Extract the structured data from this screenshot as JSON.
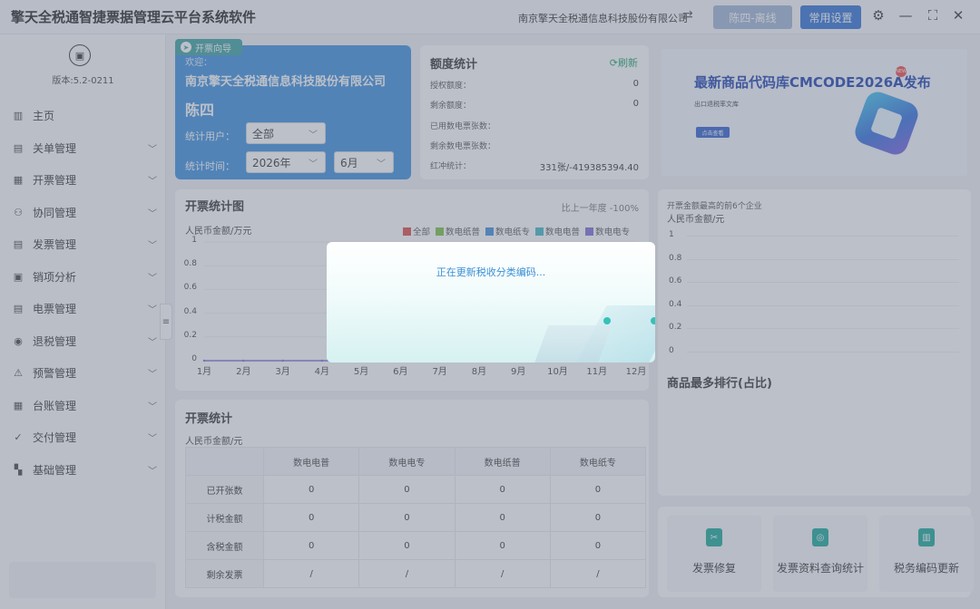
{
  "titlebar": {
    "title": "擎天全税通智捷票据管理云平台系统软件",
    "company": "南京擎天全税通信息科技股份有限公司",
    "user_button": "陈四-离线",
    "settings_button": "常用设置"
  },
  "sidebar": {
    "version": "版本:5.2-0211",
    "items": [
      {
        "label": "主页",
        "icon": "home-icon"
      },
      {
        "label": "关单管理",
        "icon": "document-icon"
      },
      {
        "label": "开票管理",
        "icon": "invoice-icon"
      },
      {
        "label": "协同管理",
        "icon": "team-icon"
      },
      {
        "label": "发票管理",
        "icon": "receipt-icon"
      },
      {
        "label": "销项分析",
        "icon": "analysis-icon"
      },
      {
        "label": "电票管理",
        "icon": "e-invoice-icon"
      },
      {
        "label": "退税管理",
        "icon": "refund-icon"
      },
      {
        "label": "预警管理",
        "icon": "warning-icon"
      },
      {
        "label": "台账管理",
        "icon": "ledger-icon"
      },
      {
        "label": "交付管理",
        "icon": "delivery-icon"
      },
      {
        "label": "基础管理",
        "icon": "grid-icon"
      }
    ]
  },
  "guide": {
    "tag": "开票向导",
    "label": "欢迎：",
    "company": "南京擎天全税通信息科技股份有限公司",
    "user": "陈四",
    "stat_user_label": "统计用户：",
    "stat_user_value": "全部",
    "stat_time_label": "统计时间：",
    "year": "2026年",
    "month": "6月"
  },
  "quota": {
    "title": "额度统计",
    "refresh": "刷新",
    "rows": [
      {
        "label": "授权额度：",
        "value": "0"
      },
      {
        "label": "剩余额度：",
        "value": "0"
      },
      {
        "label": "已用数电票张数：",
        "value": ""
      },
      {
        "label": "剩余数电票张数：",
        "value": ""
      },
      {
        "label": "红冲统计：",
        "value": "331张/-419385394.40"
      }
    ]
  },
  "banner": {
    "title": "最新商品代码库CMCODE2026A发布",
    "hot": "NEW",
    "subtitle": "出口退税率文库",
    "button": "点击查看"
  },
  "invoice_chart": {
    "title": "开票统计图",
    "compare": "比上一年度 -100%",
    "unit": "人民币金额/万元",
    "legend": [
      {
        "name": "全部",
        "color": "#e04b4b"
      },
      {
        "name": "数电纸普",
        "color": "#7cc144"
      },
      {
        "name": "数电纸专",
        "color": "#3d8ee0"
      },
      {
        "name": "数电电普",
        "color": "#3fb8c8"
      },
      {
        "name": "数电电专",
        "color": "#7b6fd8"
      }
    ],
    "y_ticks": [
      "1",
      "0.8",
      "0.6",
      "0.4",
      "0.2",
      "0"
    ],
    "x_ticks": [
      "1月",
      "2月",
      "3月",
      "4月",
      "5月",
      "6月",
      "7月",
      "8月",
      "9月",
      "10月",
      "11月",
      "12月"
    ]
  },
  "chart_data": {
    "type": "line",
    "title": "开票统计图",
    "ylabel": "人民币金额/万元",
    "xlabel": "",
    "ylim": [
      0,
      1
    ],
    "categories": [
      "1月",
      "2月",
      "3月",
      "4月",
      "5月",
      "6月",
      "7月",
      "8月",
      "9月",
      "10月",
      "11月",
      "12月"
    ],
    "series": [
      {
        "name": "全部",
        "values": [
          0,
          0,
          0,
          0,
          0,
          0,
          0,
          0,
          0,
          0,
          0,
          0
        ]
      }
    ]
  },
  "top_companies": {
    "title": "开票金额最高的前6个企业",
    "unit": "人民币金额/元",
    "y_ticks": [
      "1",
      "0.8",
      "0.6",
      "0.4",
      "0.2",
      "0"
    ],
    "rank_title": "商品最多排行(占比)"
  },
  "invoice_table": {
    "title": "开票统计",
    "unit": "人民币金额/元",
    "columns": [
      "数电电普",
      "数电电专",
      "数电纸普",
      "数电纸专"
    ],
    "rows": [
      {
        "label": "已开张数",
        "values": [
          "0",
          "0",
          "0",
          "0"
        ]
      },
      {
        "label": "计税金额",
        "values": [
          "0",
          "0",
          "0",
          "0"
        ]
      },
      {
        "label": "含税金额",
        "values": [
          "0",
          "0",
          "0",
          "0"
        ]
      },
      {
        "label": "剩余发票",
        "values": [
          "/",
          "/",
          "/",
          "/"
        ]
      }
    ]
  },
  "quick_actions": [
    {
      "label": "发票修复",
      "icon": "repair-icon"
    },
    {
      "label": "发票资料查询统计",
      "icon": "query-icon"
    },
    {
      "label": "税务编码更新",
      "icon": "update-icon"
    }
  ],
  "dialog": {
    "message": "正在更新税收分类编码..."
  }
}
